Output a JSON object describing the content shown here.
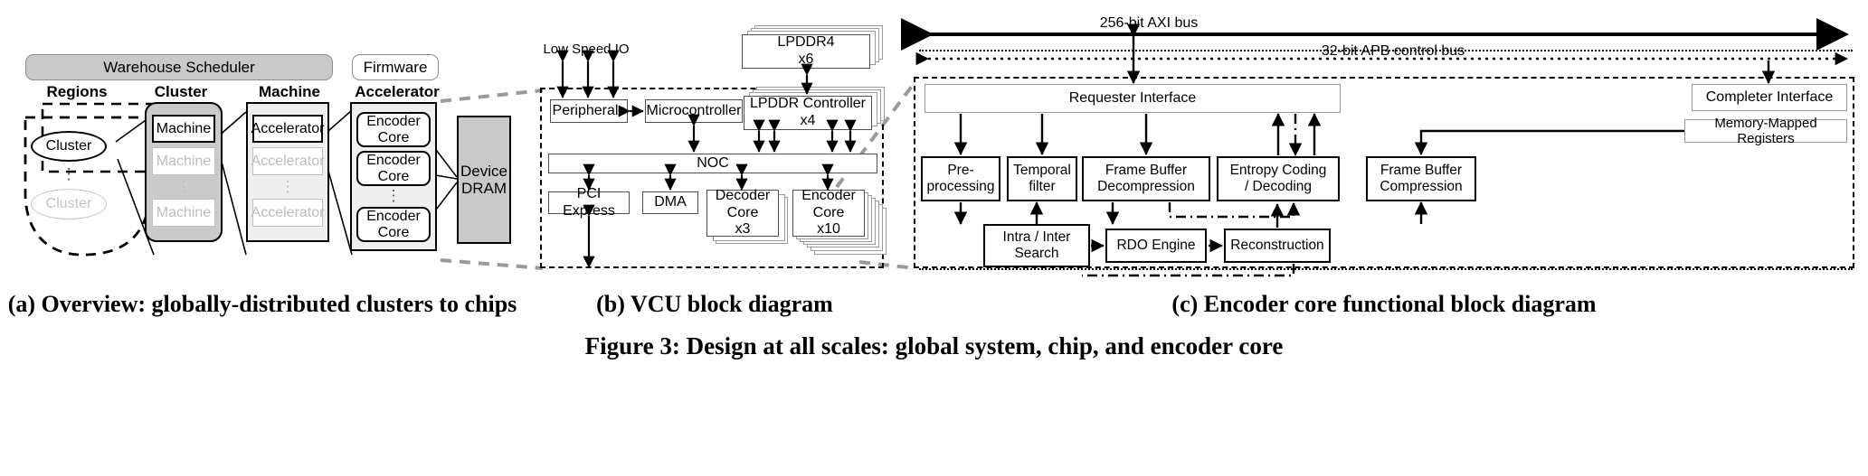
{
  "figure": {
    "caption": "Figure 3: Design at all scales: global system, chip, and encoder core",
    "subcaptions": [
      "(a) Overview: globally-distributed clusters to chips",
      "(b) VCU block diagram",
      "(c) Encoder core functional block diagram"
    ]
  },
  "panel_a": {
    "warehouse_scheduler": "Warehouse Scheduler",
    "firmware": "Firmware",
    "column_headers": [
      "Regions",
      "Cluster",
      "Machine",
      "Accelerator"
    ],
    "regions": {
      "cluster_primary": "Cluster",
      "cluster_faded": "Cluster",
      "vertical_dots": "⋮"
    },
    "cluster_stack": {
      "primary": "Machine",
      "second": "Machine",
      "last": "Machine",
      "vertical_dots": "⋮"
    },
    "machine_stack": {
      "primary": "Accelerator",
      "second": "Accelerator",
      "last": "Accelerator",
      "vertical_dots": "⋮"
    },
    "accelerator_stack": {
      "primary_line1": "Encoder",
      "primary_line2": "Core",
      "second_line1": "Encoder",
      "second_line2": "Core",
      "last_line1": "Encoder",
      "last_line2": "Core",
      "vertical_dots": "⋮"
    },
    "device_dram_line1": "Device",
    "device_dram_line2": "DRAM"
  },
  "panel_b": {
    "low_speed_io": "Low Speed IO",
    "lpddr4": {
      "name": "LPDDR4",
      "count": "x6"
    },
    "peripherals": "Peripherals",
    "microcontroller": "Microcontroller",
    "lpddr_controller": {
      "name": "LPDDR Controller",
      "count": "x4"
    },
    "noc": "NOC",
    "pci_express": "PCI Express",
    "dma": "DMA",
    "decoder_core": {
      "line1": "Decoder",
      "line2": "Core",
      "count": "x3"
    },
    "encoder_core": {
      "line1": "Encoder",
      "line2": "Core",
      "count": "x10"
    }
  },
  "panel_c": {
    "axi_bus": "256-bit AXI bus",
    "apb_bus": "32-bit APB control bus",
    "requester_interface": "Requester Interface",
    "completer_interface": "Completer Interface",
    "memory_mapped_registers": "Memory-Mapped Registers",
    "blocks": {
      "preprocessing_l1": "Pre-",
      "preprocessing_l2": "processing",
      "temporal_l1": "Temporal",
      "temporal_l2": "filter",
      "fbdecomp_l1": "Frame Buffer",
      "fbdecomp_l2": "Decompression",
      "entropy_l1": "Entropy Coding",
      "entropy_l2": "/ Decoding",
      "fbcomp_l1": "Frame Buffer",
      "fbcomp_l2": "Compression",
      "intrainter_l1": "Intra / Inter",
      "intrainter_l2": "Search",
      "rdo": "RDO Engine",
      "reconstruction": "Reconstruction"
    }
  },
  "colors": {
    "scheduler_fill": "#c9c9c9",
    "cluster_fill": "#cacaca",
    "light_fill": "#efefef",
    "dram_fill": "#c9c9c9",
    "faded_text": "#bdbdbd",
    "line": "#000000"
  }
}
